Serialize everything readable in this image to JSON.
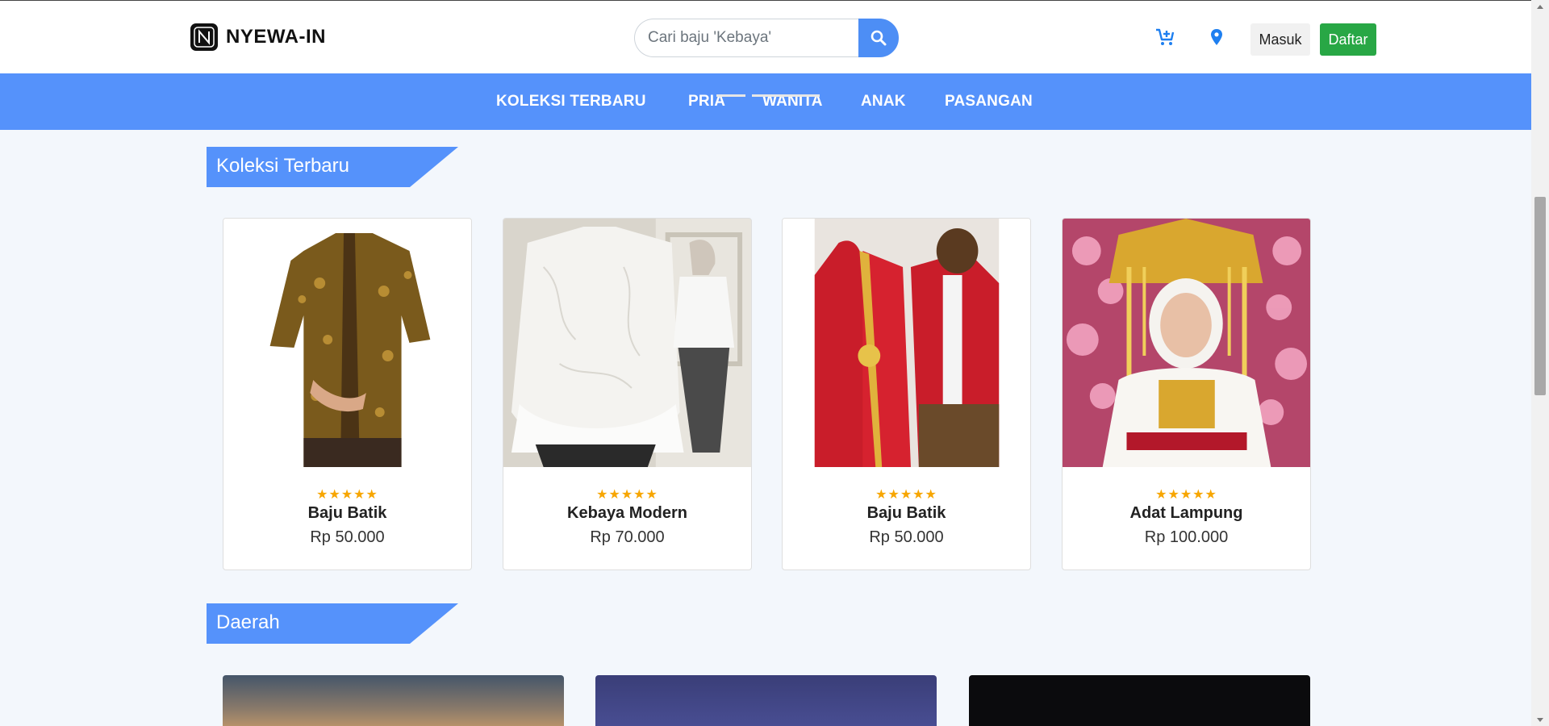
{
  "header": {
    "brand": "NYEWA-IN",
    "search_placeholder": "Cari baju 'Kebaya'",
    "icons": [
      "cart-plus-icon",
      "map-marker-icon",
      "search-icon"
    ],
    "login_label": "Masuk",
    "register_label": "Daftar"
  },
  "nav": {
    "items": [
      "KOLEKSI TERBARU",
      "PRIA",
      "WANITA",
      "ANAK",
      "PASANGAN"
    ]
  },
  "sections": {
    "latest_title": "Koleksi Terbaru",
    "region_title": "Daerah"
  },
  "products": [
    {
      "name": "Baju Batik",
      "price": "Rp 50.000",
      "rating": 5,
      "stars": "★★★★★"
    },
    {
      "name": "Kebaya Modern",
      "price": "Rp 70.000",
      "rating": 5,
      "stars": "★★★★★"
    },
    {
      "name": "Baju Batik",
      "price": "Rp 50.000",
      "rating": 5,
      "stars": "★★★★★"
    },
    {
      "name": "Adat Lampung",
      "price": "Rp 100.000",
      "rating": 5,
      "stars": "★★★★★"
    }
  ],
  "colors": {
    "accent": "#5592fb",
    "register": "#28a745",
    "star": "#f7a600",
    "page_bg": "#f3f7fc"
  }
}
